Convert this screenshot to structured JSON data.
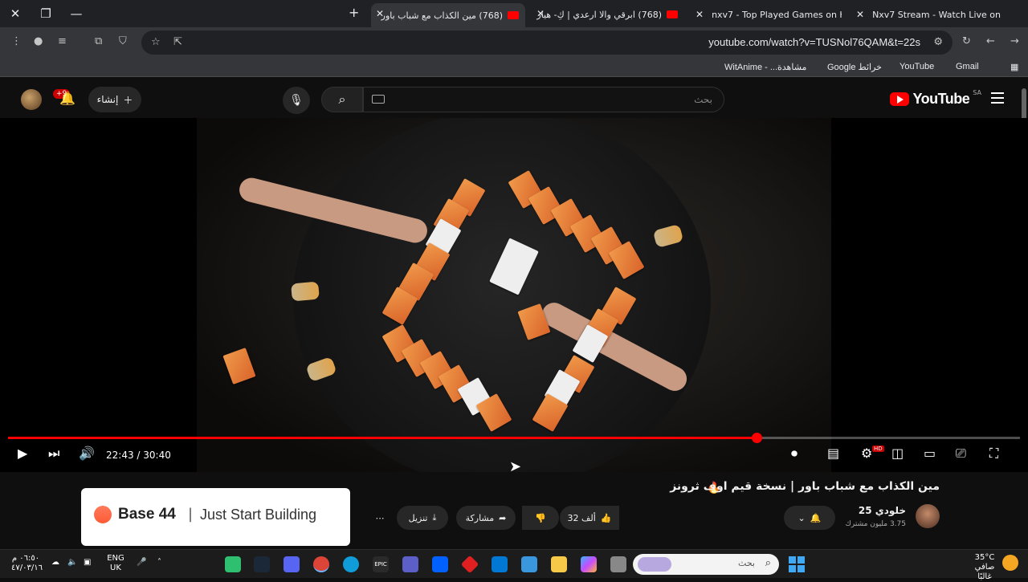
{
  "browser": {
    "tabs": [
      {
        "title": "(768) مين الكذاب مع شباب باور",
        "active": true
      },
      {
        "title": "(768) ابرقي والا ارعدي | كِ- هيار",
        "active": false
      },
      {
        "title": "nxv7 - Top Played Games on Ki",
        "active": false
      },
      {
        "title": "Nxv7 Stream - Watch Live on Ki",
        "active": false
      }
    ],
    "url": "youtube.com/watch?v=TUSNol76QAM&t=22s",
    "bookmarks": [
      "Gmail",
      "YouTube",
      "خرائط Google",
      "مشاهدة... - WitAnime"
    ]
  },
  "youtube": {
    "logo_text": "YouTube",
    "region": "SA",
    "search_placeholder": "بحث",
    "create_label": "إنشاء",
    "notif_badge": "+9"
  },
  "player": {
    "current_time": "22:43",
    "duration": "30:40",
    "time_display": "22:43 / 30:40",
    "progress": 0.74,
    "buffered": 0.78,
    "hd_badge": "HD"
  },
  "video": {
    "title": "مين الكذاب مع شباب باور | نسخة قيم اوف ثرونز",
    "channel_name": "خلودي 25",
    "subscribers": "3.75 مليون مشترك",
    "likes": "32 ألف",
    "share_label": "مشاركة",
    "download_label": "تنزيل"
  },
  "ad": {
    "brand": "Base 44",
    "tagline": "Just Start Building"
  },
  "taskbar": {
    "weather_temp": "35°C",
    "weather_desc": "صافي غالبًا",
    "search_placeholder": "بحث",
    "lang_line1": "ENG",
    "lang_line2": "UK",
    "time": "٠٦:٥٠ م",
    "date": "٤٧/٠٣/١٦"
  }
}
